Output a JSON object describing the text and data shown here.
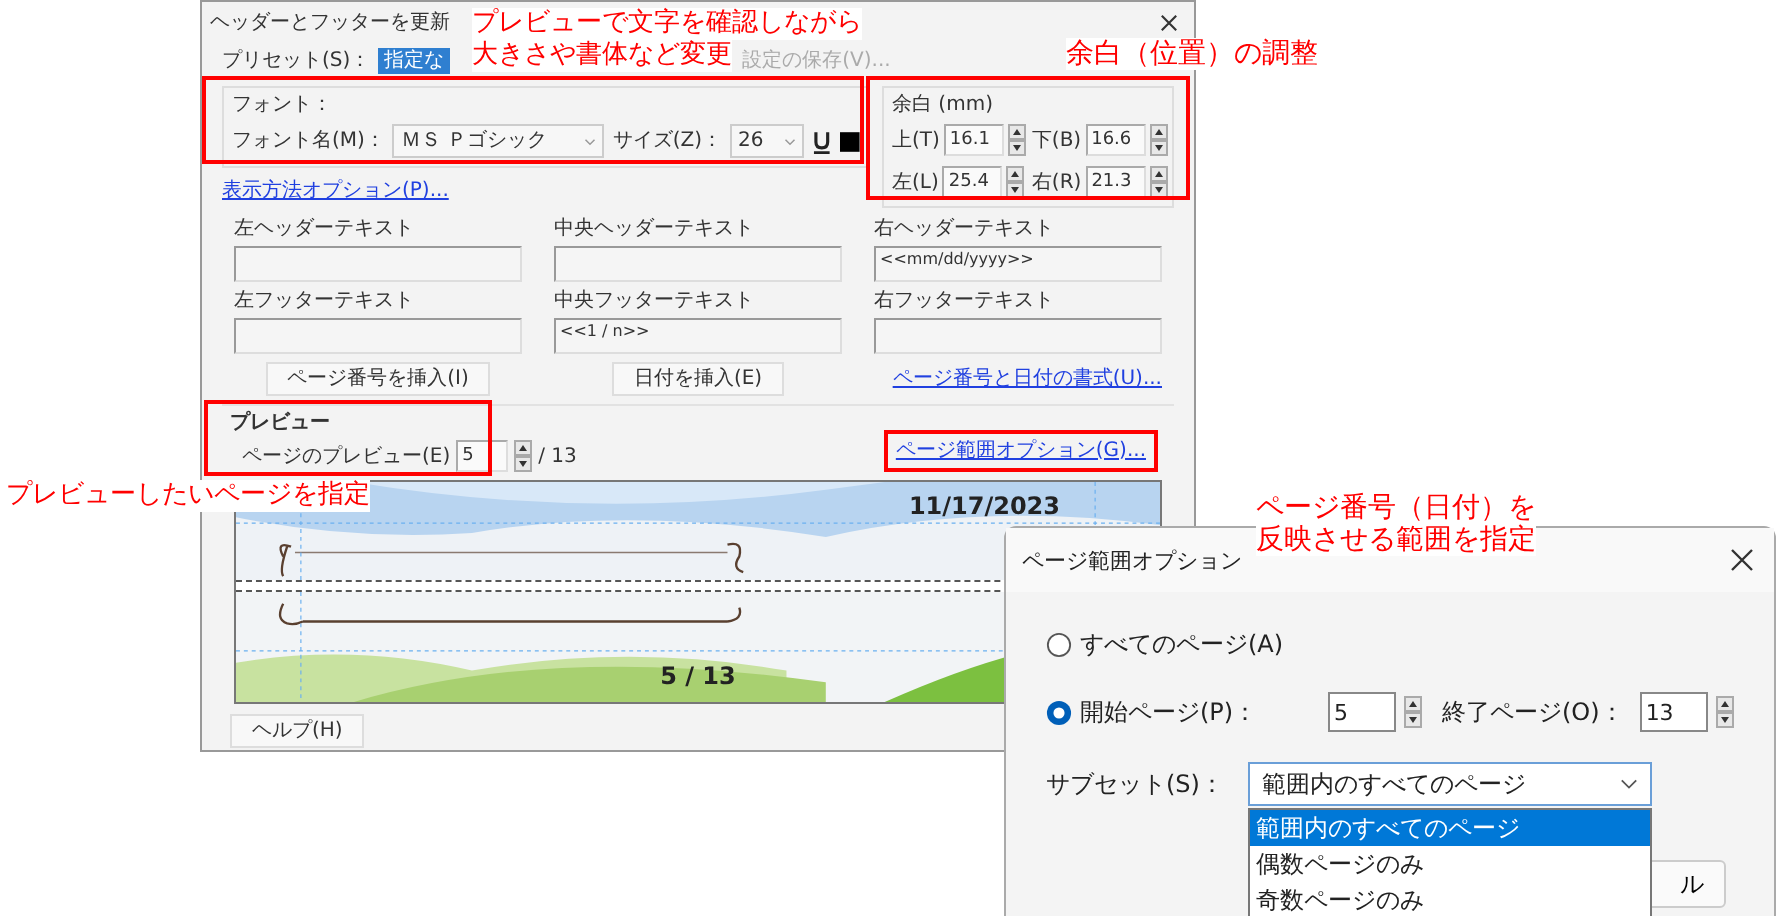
{
  "main_dialog": {
    "title": "ヘッダーとフッターを更新",
    "preset": {
      "label": "プリセット(S)：",
      "value": "指定な"
    },
    "save_preset": {
      "label": "設定の保存(V)...",
      "disabled": true
    },
    "font": {
      "group_label": "フォント：",
      "name_label": "フォント名(M)：",
      "name_value": "ＭＳ Ｐゴシック",
      "size_label": "サイズ(Z)：",
      "size_value": "26"
    },
    "display_options_link": "表示方法オプション(P)...",
    "margins": {
      "label": "余白 (mm)",
      "fields": [
        {
          "label": "上(T)",
          "value": "16.1"
        },
        {
          "label": "下(B)",
          "value": "16.6"
        },
        {
          "label": "左(L)",
          "value": "25.4"
        },
        {
          "label": "右(R)",
          "value": "21.3"
        }
      ]
    },
    "text_fields": [
      {
        "label": "左ヘッダーテキスト"
      },
      {
        "label": "中央ヘッダーテキスト"
      },
      {
        "label": "右ヘッダーテキスト",
        "value": "<<mm/dd/yyyy>>"
      },
      {
        "label": "左フッターテキスト"
      },
      {
        "label": "中央フッターテキスト",
        "value": "<<1 / n>>"
      },
      {
        "label": "右フッターテキスト"
      }
    ],
    "insert_buttons": [
      "ページ番号を挿入(I)",
      "日付を挿入(E)"
    ],
    "format_link": "ページ番号と日付の書式(U)...",
    "preview": {
      "heading": "プレビュー",
      "page_label": "ページのプレビュー(E)",
      "page_value": "5",
      "page_total": "/ 13",
      "range_link": "ページ範囲オプション(G)...",
      "header_text": "11/17/2023",
      "footer_text": "5 / 13"
    },
    "help_button": "ヘルプ(H)"
  },
  "range_dialog": {
    "title": "ページ範囲オプション",
    "options": [
      {
        "label": "すべてのページ(A)",
        "selected": false
      },
      {
        "label": "開始ページ(P)：",
        "selected": true
      }
    ],
    "start_value": "5",
    "end_label": "終了ページ(O)：",
    "end_value": "13",
    "subset_label": "サブセット(S)：",
    "subset_value": "範囲内のすべてのページ",
    "subset_options": [
      {
        "label": "範囲内のすべてのページ",
        "selected": true
      },
      {
        "label": "偶数ページのみ",
        "selected": false
      },
      {
        "label": "奇数ページのみ",
        "selected": false
      }
    ],
    "cancel_button": "ル"
  },
  "annotations": [
    {
      "lines": [
        "プレビューで文字を確認しながら",
        "大きさや書体など変更"
      ]
    },
    {
      "lines": [
        "余白（位置）の調整"
      ]
    },
    {
      "lines": [
        "プレビューしたいページを指定"
      ]
    },
    {
      "lines": [
        "ページ番号（日付）を",
        "反映させる範囲を指定"
      ]
    }
  ]
}
